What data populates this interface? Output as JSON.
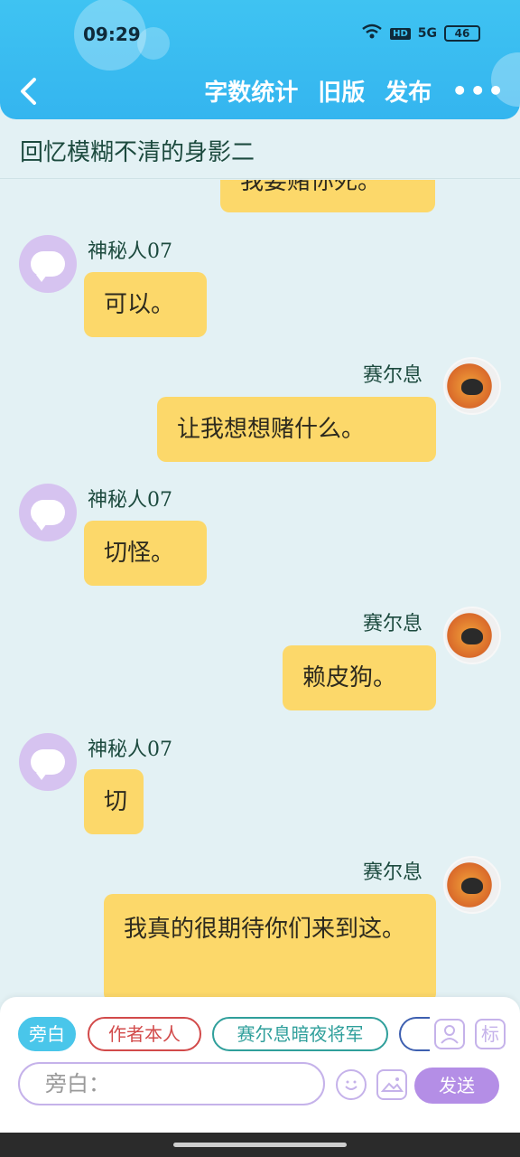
{
  "status_bar": {
    "time": "09:29",
    "net": "5G",
    "hd": "HD",
    "battery": "46"
  },
  "header": {
    "back_icon": "chevron-left-icon",
    "actions": [
      "字数统计",
      "旧版",
      "发布"
    ],
    "more_icon": "more-dots-icon",
    "more_label": "•••"
  },
  "story": {
    "title": "回忆模糊不清的身影二"
  },
  "messages": [
    {
      "side": "right",
      "name": "",
      "text": "我要赌你死。",
      "partial": true
    },
    {
      "side": "left",
      "name": "神秘人07",
      "text": "可以。"
    },
    {
      "side": "right",
      "name": "赛尔息",
      "text": "让我想想赌什么。"
    },
    {
      "side": "left",
      "name": "神秘人07",
      "text": "切怪。"
    },
    {
      "side": "right",
      "name": "赛尔息",
      "text": "赖皮狗。"
    },
    {
      "side": "left",
      "name": "神秘人07",
      "text": "切"
    },
    {
      "side": "right",
      "name": "赛尔息",
      "text": "我真的很期待你们来到这。"
    }
  ],
  "composer": {
    "chips": [
      "旁白",
      "作者本人",
      "赛尔息暗夜将军"
    ],
    "input_placeholder": "旁白：",
    "send_label": "发送",
    "tag_label": "标",
    "icons": [
      "contact-card-icon",
      "tag-icon",
      "emoji-icon",
      "image-icon"
    ]
  },
  "colors": {
    "header": "#3fc3f2",
    "bubble": "#fcd86a",
    "background": "#e3f1f4",
    "send": "#b48ee6"
  }
}
